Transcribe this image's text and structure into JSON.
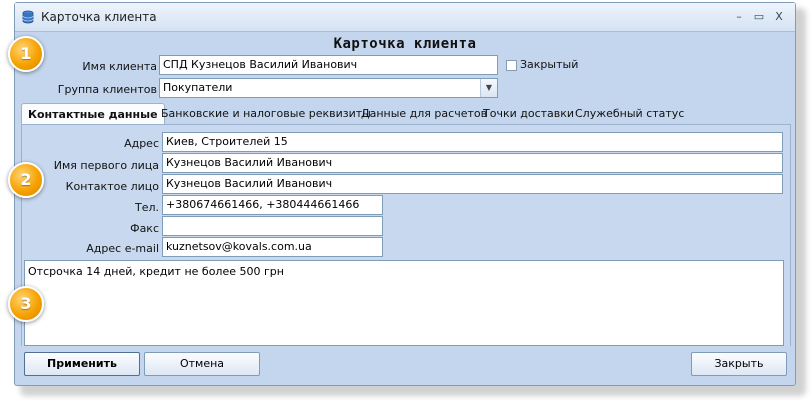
{
  "window": {
    "title": "Карточка клиента",
    "controls": [
      "–",
      "▭",
      "X"
    ]
  },
  "form": {
    "header": "Карточка клиента",
    "client_name_label": "Имя клиента",
    "client_name_value": "СПД Кузнецов Василий Иванович",
    "closed_checkbox_label": "Закрытый",
    "closed_checked": false,
    "client_group_label": "Группа клиентов",
    "client_group_value": "Покупатели",
    "client_group_arrow": "▼"
  },
  "tabs": [
    {
      "label": "Контактные данные",
      "active": true
    },
    {
      "label": "Банковские и налоговые реквизиты",
      "active": false
    },
    {
      "label": "Данные для расчетов",
      "active": false
    },
    {
      "label": "Точки доставки",
      "active": false
    },
    {
      "label": "Служебный статус",
      "active": false
    }
  ],
  "contact": {
    "address_label": "Адрес",
    "address_value": "Киев, Строителей 15",
    "first_person_label": "Имя первого лица",
    "first_person_value": "Кузнецов Василий Иванович",
    "contact_person_label": "Контактое лицо",
    "contact_person_value": "Кузнецов Василий Иванович",
    "phone_label": "Тел.",
    "phone_value": "+380674661466, +380444661466",
    "fax_label": "Факс",
    "fax_value": "",
    "email_label": "Адрес e-mail",
    "email_value": "kuznetsov@kovals.com.ua"
  },
  "notes": "Отсрочка 14 дней, кредит не более 500 грн",
  "buttons": {
    "apply": "Применить",
    "cancel": "Отмена",
    "close": "Закрыть"
  },
  "callouts": [
    "1",
    "2",
    "3"
  ],
  "colors": {
    "window_bg": "#c4d6ee",
    "badge": "#f6a200"
  }
}
